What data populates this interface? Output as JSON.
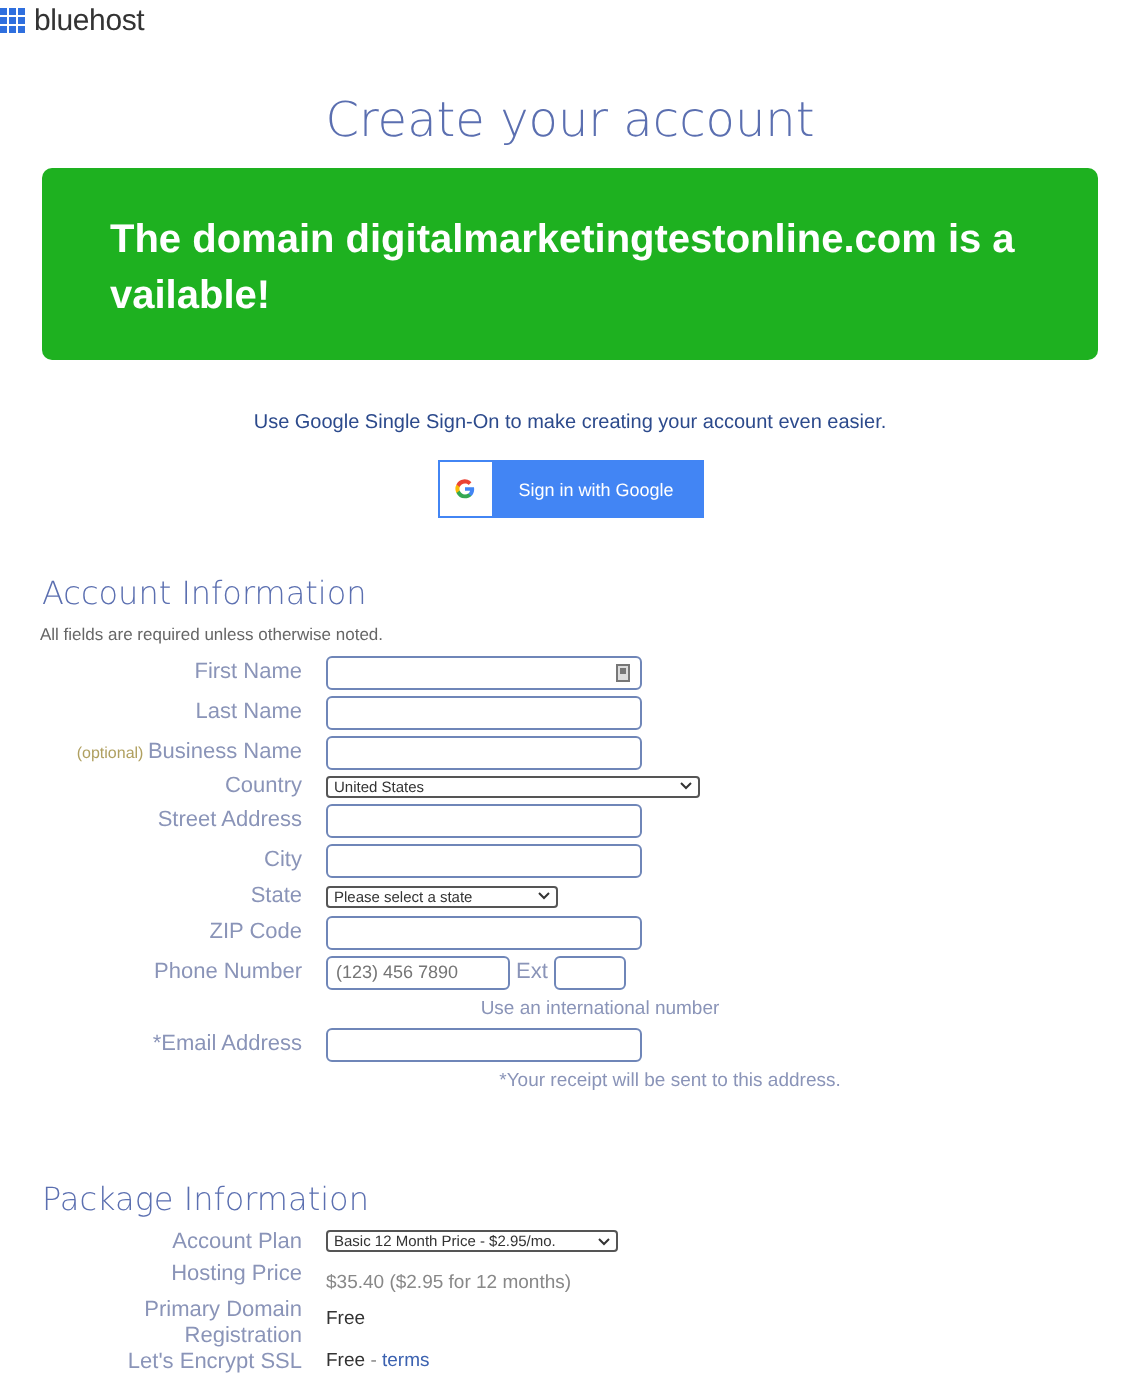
{
  "header": {
    "logo_text": "bluehost"
  },
  "page_title": "Create your account",
  "banner": {
    "message": "The domain digitalmarketingtestonline.com is available!"
  },
  "sso": {
    "prompt": "Use Google Single Sign-On to make creating your account even easier.",
    "button": "Sign in with Google"
  },
  "account_information": {
    "heading": "Account Information",
    "note": "All fields are required unless otherwise noted.",
    "fields": [
      {
        "kind": "text",
        "label": "First Name",
        "autofill_icon": true
      },
      {
        "kind": "text",
        "label": "Last Name"
      },
      {
        "kind": "text",
        "label": "Business Name",
        "optional_tag": "(optional)"
      },
      {
        "kind": "select",
        "label": "Country",
        "value": "United States",
        "wide": true
      },
      {
        "kind": "text",
        "label": "Street Address"
      },
      {
        "kind": "text",
        "label": "City"
      },
      {
        "kind": "select",
        "label": "State",
        "value": "Please select a state"
      },
      {
        "kind": "text",
        "label": "ZIP Code"
      },
      {
        "kind": "phone",
        "label": "Phone Number",
        "placeholder": "(123) 456 7890",
        "ext_label": "Ext"
      },
      {
        "kind": "hint",
        "text": "Use an international number"
      },
      {
        "kind": "text",
        "label": "*Email Address"
      },
      {
        "kind": "hint",
        "text": "*Your receipt will be sent to this address."
      }
    ]
  },
  "package_information": {
    "heading": "Package Information",
    "rows": [
      {
        "kind": "select",
        "label": "Account Plan",
        "value": "Basic 12 Month Price - $2.95/mo."
      },
      {
        "kind": "price",
        "label": "Hosting Price",
        "value": "$35.40",
        "detail": "($2.95 for 12 months)"
      },
      {
        "kind": "value",
        "label": "Primary Domain Registration",
        "value": "Free"
      },
      {
        "kind": "link",
        "label": "Let's Encrypt SSL",
        "value": "Free",
        "separator": "-",
        "link": "terms"
      }
    ]
  }
}
